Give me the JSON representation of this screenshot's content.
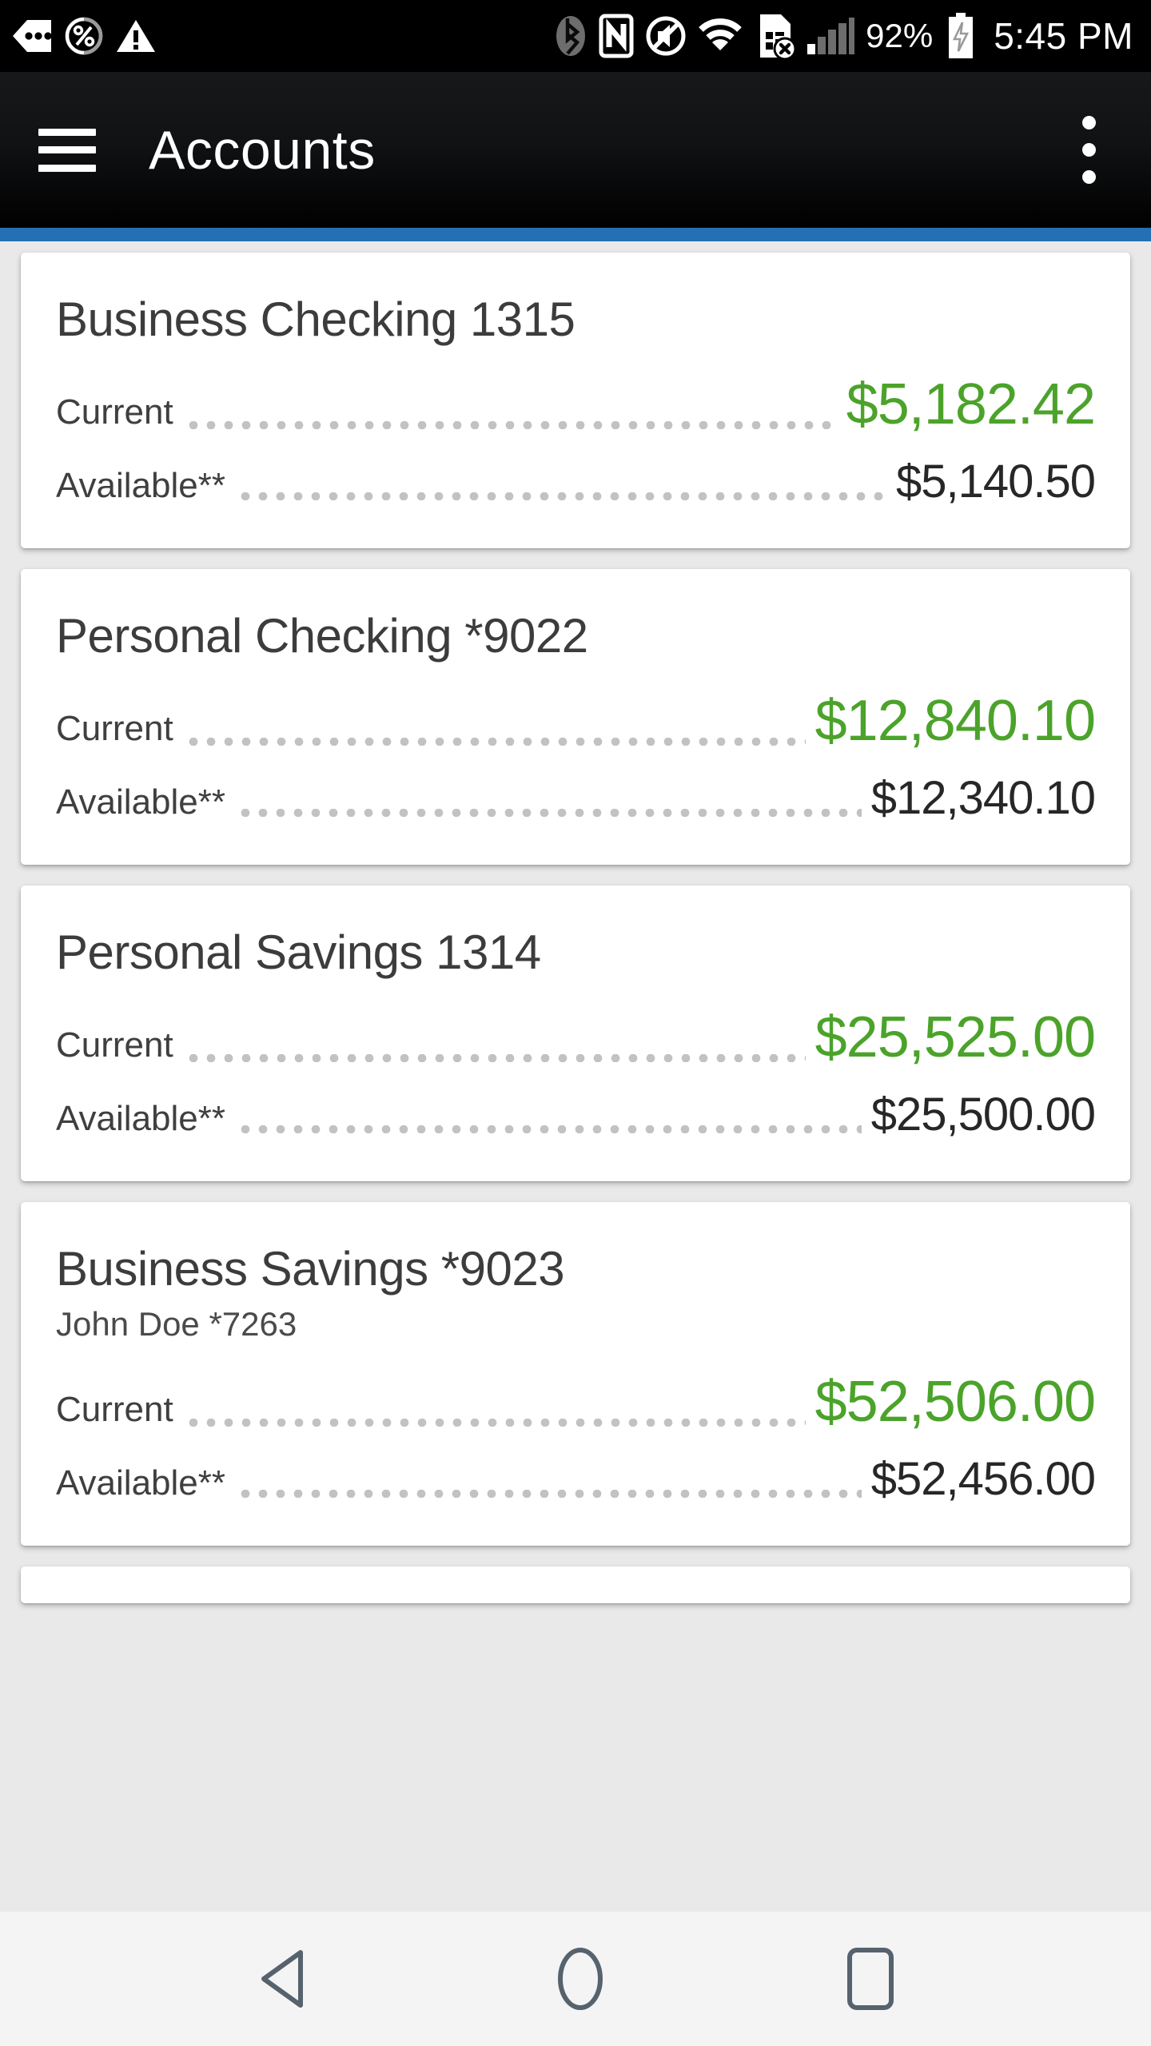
{
  "statusbar": {
    "left_icons": [
      "more-notifications-icon",
      "data-saver-percent-icon",
      "warning-triangle-icon"
    ],
    "right_icons": [
      "bluetooth-icon",
      "nfc-icon",
      "volume-muted-icon",
      "wifi-icon",
      "sim-card-error-icon",
      "cellular-signal-icon"
    ],
    "battery_percent": "92%",
    "battery_icon": "battery-charging-icon",
    "time": "5:45 PM"
  },
  "appbar": {
    "menu_icon": "hamburger-menu-icon",
    "title": "Accounts",
    "overflow_icon": "overflow-menu-icon",
    "accent_color": "#2470b3"
  },
  "colors": {
    "current_balance": "#4ba32a",
    "available_balance": "#272727",
    "page_background": "#e9e9e9",
    "card_background": "#ffffff"
  },
  "labels": {
    "current": "Current",
    "available": "Available**"
  },
  "accounts": [
    {
      "name": "Business Checking 1315",
      "subtitle": "",
      "current_label": "Current",
      "current_value": "$5,182.42",
      "available_label": "Available**",
      "available_value": "$5,140.50"
    },
    {
      "name": "Personal Checking *9022",
      "subtitle": "",
      "current_label": "Current",
      "current_value": "$12,840.10",
      "available_label": "Available**",
      "available_value": "$12,340.10"
    },
    {
      "name": "Personal Savings 1314",
      "subtitle": "",
      "current_label": "Current",
      "current_value": "$25,525.00",
      "available_label": "Available**",
      "available_value": "$25,500.00"
    },
    {
      "name": "Business Savings *9023",
      "subtitle": "John Doe *7263",
      "current_label": "Current",
      "current_value": "$52,506.00",
      "available_label": "Available**",
      "available_value": "$52,456.00"
    }
  ],
  "navbar": {
    "back": "back-button",
    "home": "home-button",
    "recents": "recents-button"
  }
}
